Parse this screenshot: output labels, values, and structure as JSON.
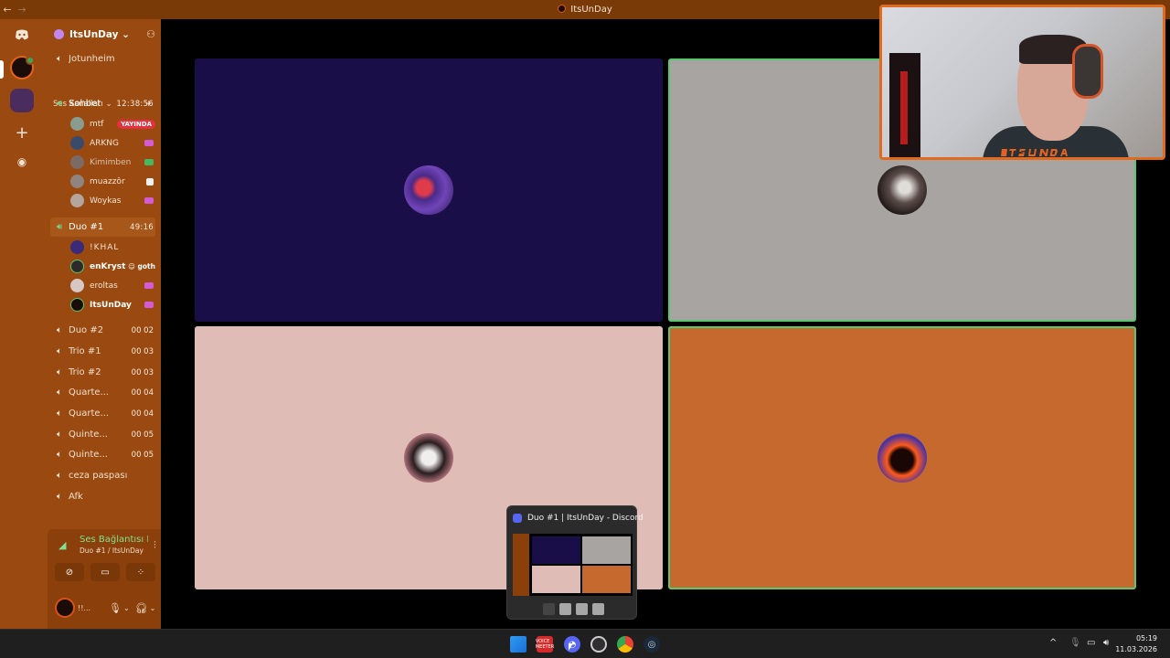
{
  "window": {
    "title": "ItsUnDay",
    "back_icon": "←",
    "forward_icon": "→"
  },
  "server": {
    "name": "ItsUnDay ⌄",
    "invite_icon": "person-plus-icon"
  },
  "channels": {
    "text_channel": "Jotunheim",
    "category": "Ses Kanalları ⌄",
    "category_add": "+",
    "voice": [
      {
        "name": "Sohbet",
        "timer": "12:38:56"
      },
      {
        "name": "Duo #1",
        "timer": "49:16"
      },
      {
        "name": "Duo #2",
        "count": "00  02"
      },
      {
        "name": "Trio #1",
        "count": "00  03"
      },
      {
        "name": "Trio #2",
        "count": "00  03"
      },
      {
        "name": "Quarte...",
        "count": "00  04"
      },
      {
        "name": "Quarte...",
        "count": "00  04"
      },
      {
        "name": "Quinte...",
        "count": "00  05"
      },
      {
        "name": "Quinte...",
        "count": "00  05"
      },
      {
        "name": "ceza paspası"
      },
      {
        "name": "Afk"
      }
    ],
    "sohbet_members": [
      {
        "name": "mtf",
        "live": "YAYINDA"
      },
      {
        "name": "ARKNG"
      },
      {
        "name": "Kimimben"
      },
      {
        "name": "muazzôr"
      },
      {
        "name": "Woykas"
      }
    ],
    "duo_members": [
      {
        "name": "!KHAL"
      },
      {
        "name": "enKryst",
        "tag": "☺ goth"
      },
      {
        "name": "eroltas"
      },
      {
        "name": "ItsUnDay"
      }
    ]
  },
  "voice_panel": {
    "status": "Ses Bağlantısı K",
    "location": "Duo #1 / ItsUnDay",
    "username": "!!..."
  },
  "popup": {
    "title": "Duo #1 | ItsUnDay - Discord"
  },
  "taskbar": {
    "vm_label": "VOICE MEETER"
  },
  "clock": {
    "time": "05:19",
    "date": "11.03.2026"
  },
  "colors": {
    "accent": "#9a4a10",
    "speaking": "#5ac770",
    "live": "#e3313f"
  }
}
